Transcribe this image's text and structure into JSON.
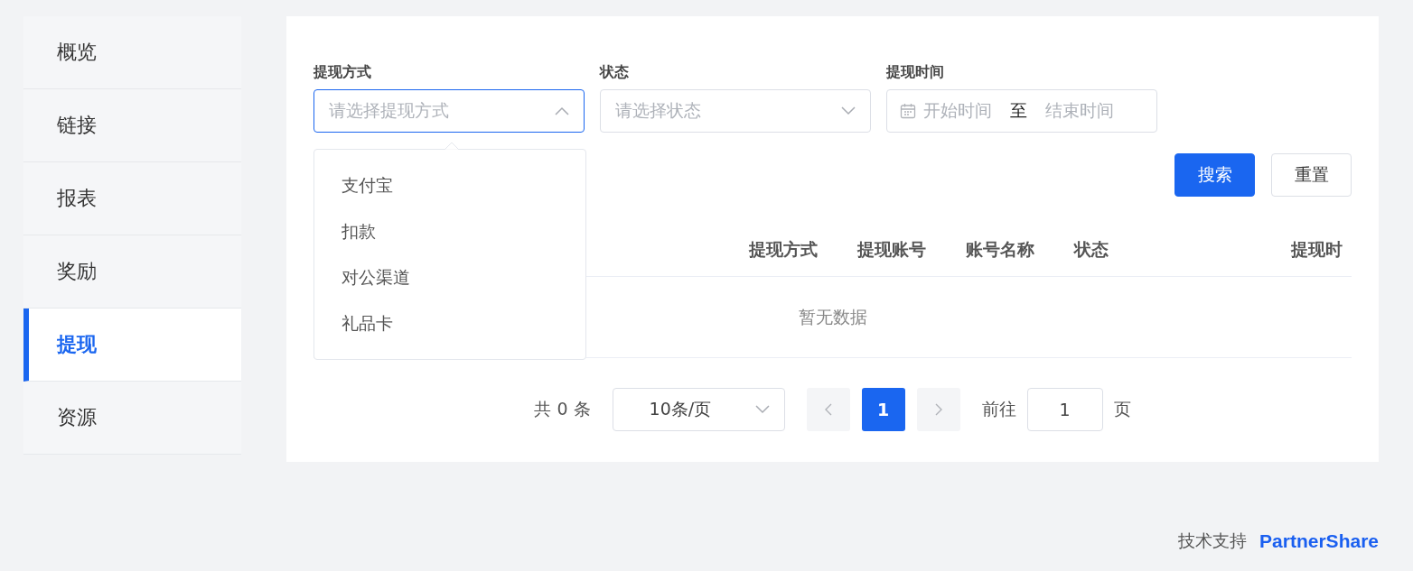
{
  "sidebar": {
    "items": [
      {
        "label": "概览",
        "selected": false
      },
      {
        "label": "链接",
        "selected": false
      },
      {
        "label": "报表",
        "selected": false
      },
      {
        "label": "奖励",
        "selected": false
      },
      {
        "label": "提现",
        "selected": true
      },
      {
        "label": "资源",
        "selected": false
      }
    ]
  },
  "filters": {
    "method": {
      "label": "提现方式",
      "placeholder": "请选择提现方式",
      "expanded": true,
      "options": [
        {
          "label": "支付宝",
          "selected": false
        },
        {
          "label": "扣款",
          "selected": false
        },
        {
          "label": "对公渠道",
          "selected": false
        },
        {
          "label": "礼品卡",
          "selected": false
        }
      ]
    },
    "status": {
      "label": "状态",
      "placeholder": "请选择状态",
      "expanded": false
    },
    "time": {
      "label": "提现时间",
      "start_placeholder": "开始时间",
      "separator": "至",
      "end_placeholder": "结束时间"
    },
    "buttons": [
      {
        "label": "搜索",
        "kind": "primary"
      },
      {
        "label": "重置",
        "kind": "default"
      }
    ]
  },
  "table": {
    "columns": [
      "提现方式",
      "提现账号",
      "账号名称",
      "状态",
      "提现时"
    ],
    "empty_text": "暂无数据"
  },
  "pagination": {
    "total": "共 0 条",
    "page_size": "10条/页",
    "pages": [
      {
        "label": "1",
        "selected": true
      }
    ],
    "goto_label": "前往",
    "goto_value": "1",
    "goto_suffix": "页"
  },
  "footer": {
    "label": "技术支持",
    "logo": "PartnerShare"
  }
}
